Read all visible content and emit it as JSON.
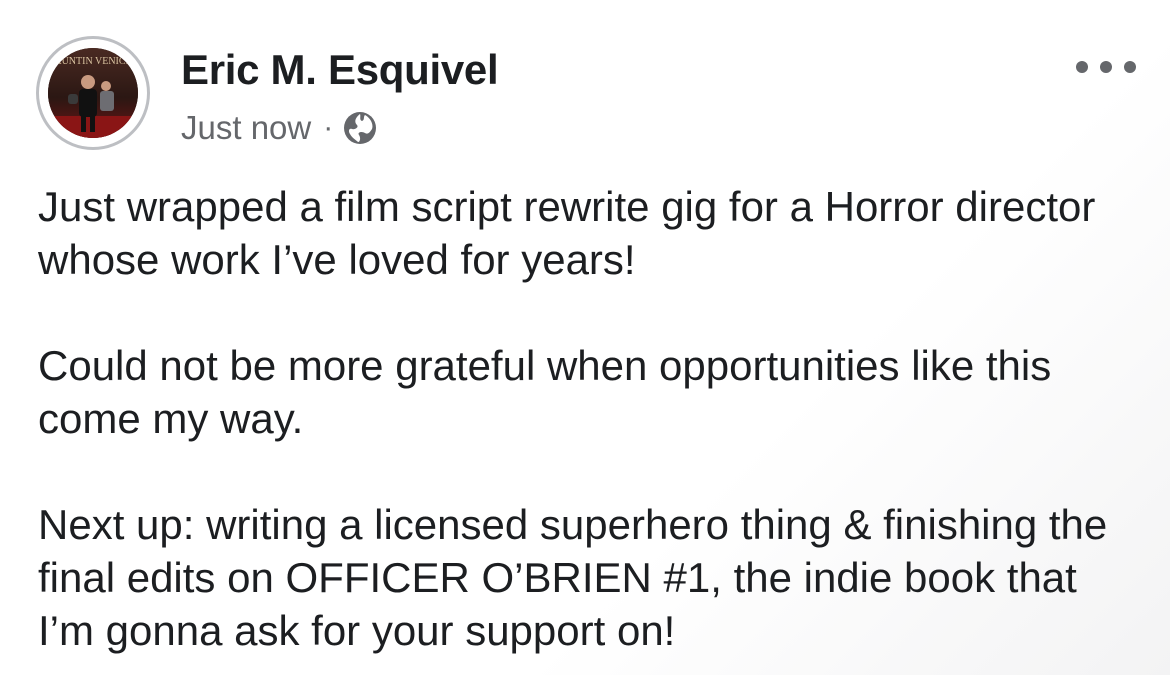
{
  "post": {
    "author": "Eric M. Esquivel",
    "timestamp": "Just now",
    "separator": "·",
    "audience_icon": "globe-icon",
    "avatar_sign_text": "AUNTIN VENICE",
    "more_icon": "more-horizontal-icon",
    "paragraphs": [
      "Just wrapped a film script rewrite gig for a Horror director whose work I’ve loved for years!",
      "Could not be more grateful when opportunities like this come my way.",
      "Next up: writing a licensed superhero thing & finishing the final edits on OFFICER O’BRIEN #1, the indie book that I’m gonna ask for your support on!"
    ]
  },
  "colors": {
    "text_primary": "#1c1e21",
    "text_secondary": "#65676b",
    "avatar_ring": "#bdbfc3"
  }
}
